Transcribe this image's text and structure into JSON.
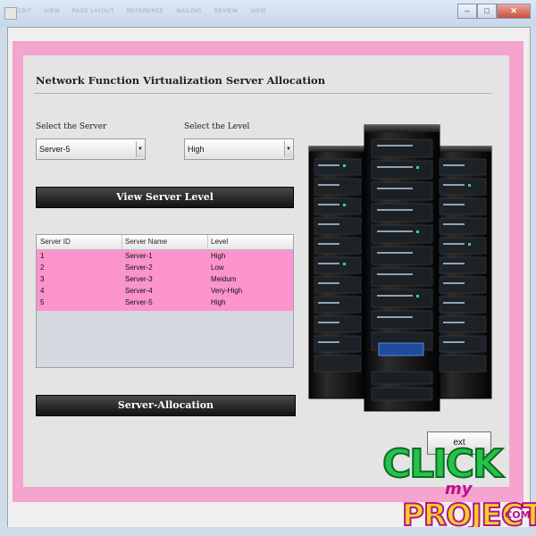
{
  "window": {
    "menu_items": [
      "EDIT",
      "VIEW",
      "PAGE LAYOUT",
      "REFERENCE",
      "MAILING",
      "REVIEW",
      "VIEW"
    ],
    "controls": {
      "minimize": "–",
      "maximize": "□",
      "close": "✕"
    }
  },
  "page": {
    "heading": "Network Function Virtualization Server Allocation"
  },
  "server_select": {
    "label": "Select the Server",
    "value": "Server-5",
    "arrow": "▼"
  },
  "level_select": {
    "label": "Select the Level",
    "value": "High",
    "arrow": "▼"
  },
  "buttons": {
    "view_server_level": "View Server Level",
    "server_allocation": "Server-Allocation",
    "next": "ext"
  },
  "table": {
    "columns": [
      "Server ID",
      "Server Name",
      "Level"
    ],
    "rows": [
      [
        "1",
        "Server-1",
        "High"
      ],
      [
        "2",
        "Server-2",
        "Low"
      ],
      [
        "3",
        "Server-3",
        "Meidum"
      ],
      [
        "4",
        "Server-4",
        "Very-High"
      ],
      [
        "5",
        "Server-5",
        "High"
      ]
    ]
  },
  "watermark": {
    "line1": "CLICK",
    "line2": "my",
    "line3": "PROJECT",
    "suffix": ".COM"
  },
  "colors": {
    "pink_frame": "#f5a3cf",
    "table_rows": "#fb94cc",
    "button_dark": "#1a1a1a",
    "watermark_green": "#26c24a",
    "watermark_yellow": "#f2d51a",
    "watermark_magenta": "#b8148a"
  }
}
